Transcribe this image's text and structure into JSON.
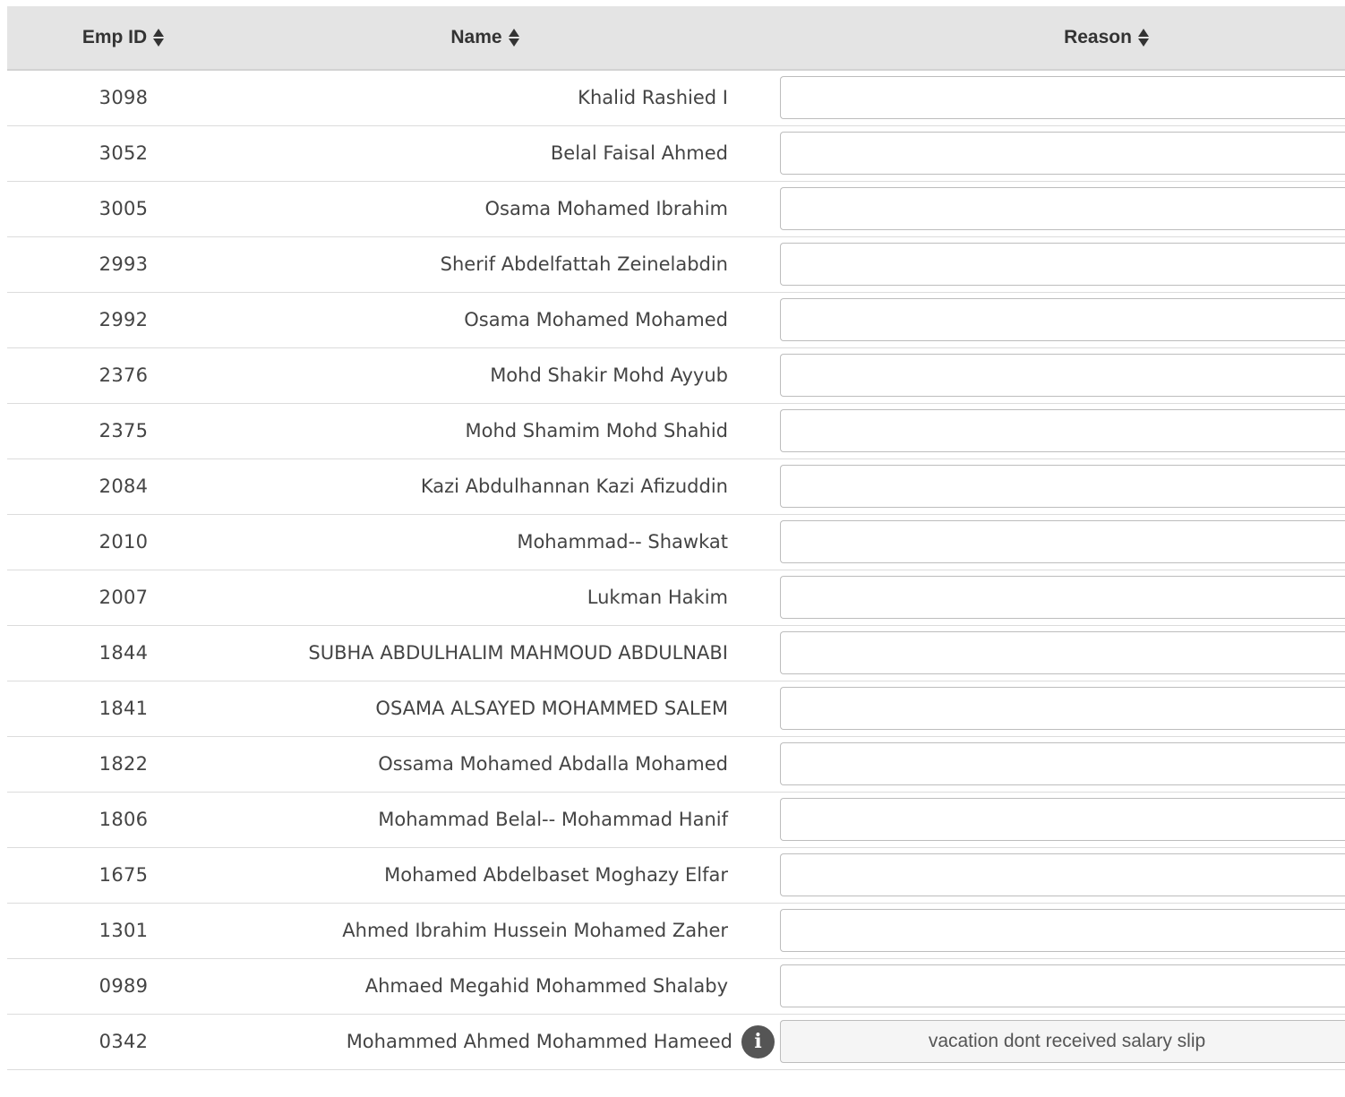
{
  "table": {
    "headers": {
      "emp_id": "Emp ID",
      "name": "Name",
      "reason": "Reason"
    },
    "sort_icon": "sort-icon",
    "info_icon": "info-icon",
    "rows": [
      {
        "emp_id": "3098",
        "name": "Khalid Rashied I",
        "reason": ""
      },
      {
        "emp_id": "3052",
        "name": "Belal Faisal Ahmed",
        "reason": ""
      },
      {
        "emp_id": "3005",
        "name": "Osama Mohamed Ibrahim",
        "reason": ""
      },
      {
        "emp_id": "2993",
        "name": "Sherif Abdelfattah Zeinelabdin",
        "reason": ""
      },
      {
        "emp_id": "2992",
        "name": "Osama Mohamed Mohamed",
        "reason": ""
      },
      {
        "emp_id": "2376",
        "name": "Mohd Shakir Mohd Ayyub",
        "reason": ""
      },
      {
        "emp_id": "2375",
        "name": "Mohd Shamim Mohd Shahid",
        "reason": ""
      },
      {
        "emp_id": "2084",
        "name": "Kazi Abdulhannan Kazi Afizuddin",
        "reason": ""
      },
      {
        "emp_id": "2010",
        "name": "Mohammad-- Shawkat",
        "reason": ""
      },
      {
        "emp_id": "2007",
        "name": "Lukman Hakim",
        "reason": ""
      },
      {
        "emp_id": "1844",
        "name": "SUBHA ABDULHALIM MAHMOUD ABDULNABI",
        "reason": ""
      },
      {
        "emp_id": "1841",
        "name": "OSAMA ALSAYED MOHAMMED SALEM",
        "reason": ""
      },
      {
        "emp_id": "1822",
        "name": "Ossama Mohamed Abdalla Mohamed",
        "reason": ""
      },
      {
        "emp_id": "1806",
        "name": "Mohammad Belal-- Mohammad Hanif",
        "reason": ""
      },
      {
        "emp_id": "1675",
        "name": "Mohamed Abdelbaset Moghazy Elfar",
        "reason": ""
      },
      {
        "emp_id": "1301",
        "name": "Ahmed Ibrahim Hussein Mohamed Zaher",
        "reason": ""
      },
      {
        "emp_id": "0989",
        "name": "Ahmaed Megahid Mohammed Shalaby",
        "reason": ""
      },
      {
        "emp_id": "0342",
        "name": "Mohammed Ahmed Mohammed Hameed",
        "reason": "vacation dont received salary slip",
        "has_info": true
      }
    ]
  }
}
